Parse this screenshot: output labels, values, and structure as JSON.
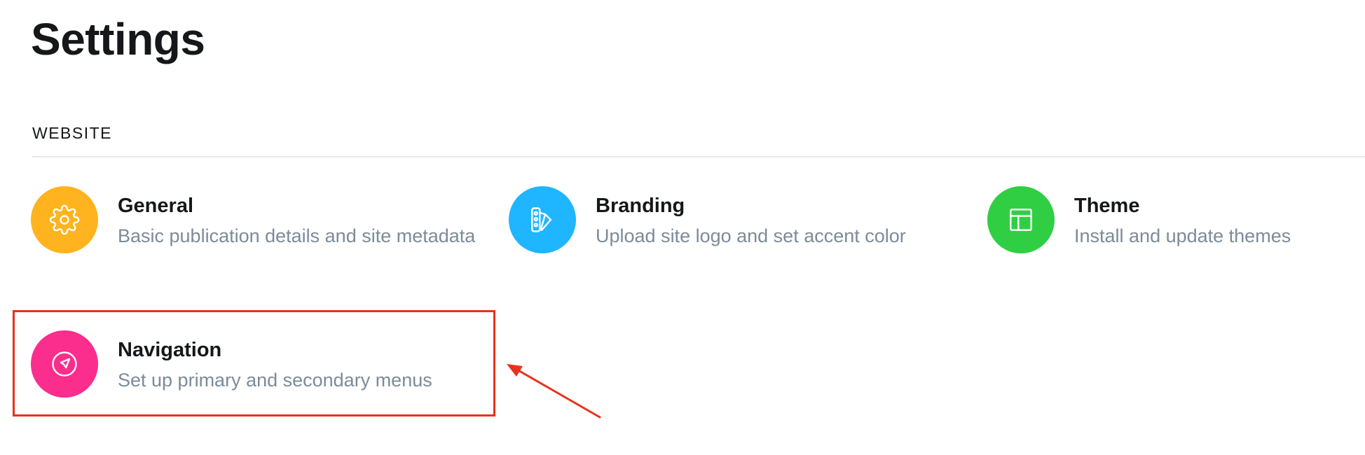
{
  "page": {
    "title": "Settings"
  },
  "section": {
    "label": "WEBSITE"
  },
  "items": [
    {
      "title": "General",
      "description": "Basic publication details and site metadata",
      "icon": "gear-icon",
      "color": "#ffb41f"
    },
    {
      "title": "Branding",
      "description": "Upload site logo and set accent color",
      "icon": "palette-swatch-icon",
      "color": "#1fb6ff"
    },
    {
      "title": "Theme",
      "description": "Install and update themes",
      "icon": "layout-icon",
      "color": "#30cf43"
    },
    {
      "title": "Navigation",
      "description": "Set up primary and secondary menus",
      "icon": "compass-arrow-icon",
      "color": "#fb2d8d"
    }
  ],
  "annotation": {
    "highlight_color": "#e8321c",
    "target": "Navigation"
  }
}
